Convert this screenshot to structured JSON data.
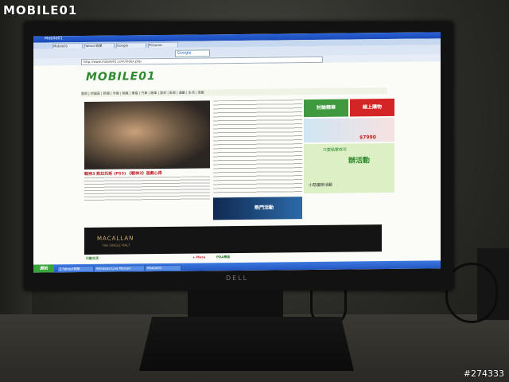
{
  "watermark": "MOBILE01",
  "photo_id": "#274333",
  "monitor": {
    "brand": "DELL"
  },
  "browser": {
    "window_title": "Mobile01",
    "tabs": [
      "Mobile01",
      "Yahoo!奇摩",
      "Google",
      "PChome"
    ],
    "search_text": "Google",
    "address": "http://www.mobile01.com/index.php"
  },
  "site": {
    "logo": "MOBILE01",
    "nav": "首頁 | 討論區 | 新聞 | 手機 | 相機 | 筆電 | 汽車 | 機車 | 居家 | 影音 | 運動 | 生活 | 遊戲",
    "hero_title": "戰神3 凱拉托斯 (PS3) 《戰神3》遊戲心得",
    "ads": {
      "ad1": "討論精華",
      "ad2": "線上購物",
      "price": "$7990",
      "ad4_small": "只要點擊就可",
      "ad4_big": "辦活動",
      "ad4_bottom": "小惡魔辦活動"
    },
    "promo": "熱門活動",
    "banner": {
      "brand": "MACALLAN",
      "sub": "THE SINGLE MALT"
    },
    "sections": [
      "行動生活",
      "PDA專區",
      "+ More"
    ]
  },
  "taskbar": {
    "start": "開始",
    "items": [
      "2 Yahoo!奇摩",
      "Windows Live Messen",
      "Mobile01"
    ]
  }
}
